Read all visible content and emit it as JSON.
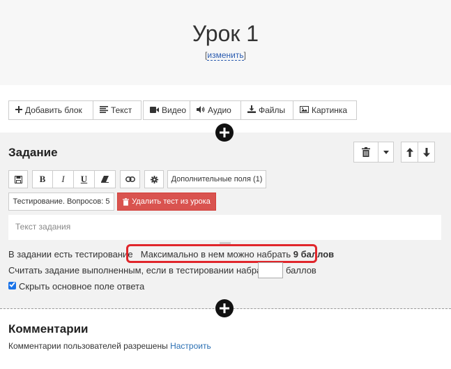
{
  "lesson": {
    "title": "Урок 1",
    "rename_open": "[",
    "rename_label": "изменить",
    "rename_close": "]"
  },
  "toolbar": {
    "add_block": "Добавить блок",
    "text": "Текст",
    "video": "Видео",
    "audio": "Аудио",
    "files": "Файлы",
    "picture": "Картинка"
  },
  "task": {
    "title": "Задание",
    "extra_fields": "Дополнительные поля (1)",
    "testing": "Тестирование. Вопросов: 5",
    "delete_test": "Удалить тест из урока",
    "text_placeholder": "Текст задания",
    "has_testing": "В задании есть тестирование",
    "max_score_prefix": "Максимально в нем можно набрать",
    "max_score_value": "9 баллов",
    "complete_condition": "Считать задание выполненным, если в тестировании набрано",
    "points_suffix": "баллов",
    "hide_answer": "Скрыть основное поле ответа"
  },
  "comments": {
    "title": "Комментарии",
    "status": "Комментарии пользователей разрешены",
    "configure": "Настроить"
  },
  "icons": {
    "plus": "plus-icon",
    "trash": "trash-icon",
    "arrow_up": "arrow-up-icon",
    "arrow_down": "arrow-down-icon",
    "save": "save-icon",
    "link": "link-icon",
    "gear": "gear-icon"
  },
  "colors": {
    "delete_button": "#d9534f",
    "highlight": "#e0262b",
    "link": "#2a6fb3"
  }
}
